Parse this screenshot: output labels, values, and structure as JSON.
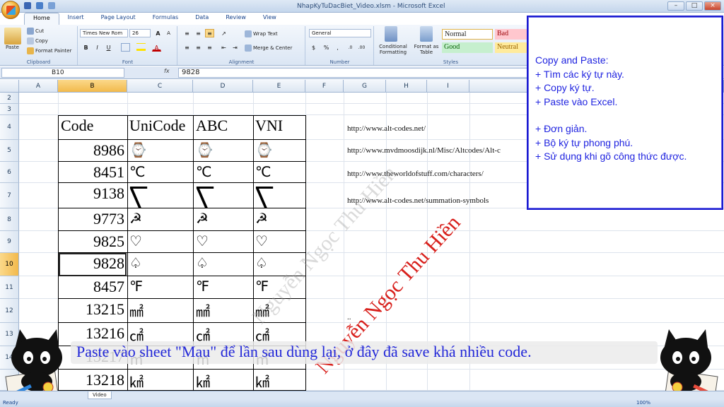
{
  "window": {
    "title": "NhapKyTuDacBiet_Video.xlsm - Microsoft Excel"
  },
  "ribbon_tabs": [
    "Home",
    "Insert",
    "Page Layout",
    "Formulas",
    "Data",
    "Review",
    "View"
  ],
  "clipboard": {
    "paste": "Paste",
    "cut": "Cut",
    "copy": "Copy",
    "format_painter": "Format Painter",
    "label": "Clipboard"
  },
  "font": {
    "name": "Times New Rom",
    "size": "26",
    "bold": "B",
    "italic": "I",
    "underline": "U",
    "grow": "A",
    "shrink": "A",
    "label": "Font"
  },
  "alignment": {
    "wrap_text": "Wrap Text",
    "merge_center": "Merge & Center",
    "label": "Alignment"
  },
  "number": {
    "format": "General",
    "currency": "$",
    "percent": "%",
    "comma": ",",
    "label": "Number"
  },
  "styles": {
    "conditional_formatting": "Conditional Formatting",
    "format_as_table": "Format as Table",
    "label": "Styles",
    "normal": "Normal",
    "bad": "Bad",
    "good": "Good",
    "neutral": "Neutral"
  },
  "formula_bar": {
    "name_box": "B10",
    "fx": "fx",
    "formula": "9828"
  },
  "columns": [
    "A",
    "B",
    "C",
    "D",
    "E",
    "F",
    "G",
    "H",
    "I"
  ],
  "rows": [
    "2",
    "3",
    "4",
    "5",
    "6",
    "7",
    "8",
    "9",
    "10",
    "11",
    "12",
    "13",
    "14",
    "15"
  ],
  "table": {
    "headers": [
      "Code",
      "UniCode",
      "ABC",
      "VNI"
    ],
    "rows": [
      {
        "code": "8986",
        "glyph": "⌚"
      },
      {
        "code": "8451",
        "glyph": "℃"
      },
      {
        "code": "9138",
        "glyph": "⎲"
      },
      {
        "code": "9773",
        "glyph": "☭"
      },
      {
        "code": "9825",
        "glyph": "♡"
      },
      {
        "code": "9828",
        "glyph": "♤"
      },
      {
        "code": "8457",
        "glyph": "℉"
      },
      {
        "code": "13215",
        "glyph": "㎟"
      },
      {
        "code": "13216",
        "glyph": "㎠"
      },
      {
        "code": "13217",
        "glyph": "㎡"
      },
      {
        "code": "13218",
        "glyph": "㎢"
      }
    ]
  },
  "links": [
    "http://www.alt-codes.net/",
    "http://www.mvdmoosdijk.nl/Misc/Altcodes/Alt-c",
    "http://www.theworldofstuff.com/characters/",
    "http://www.alt-codes.net/summation-symbols",
    ".."
  ],
  "watermark": "Nguyễn Ngọc Thu Hiền",
  "note": {
    "lines": [
      "Copy and Paste:",
      "+ Tìm các ký tự này.",
      "+ Copy ký tự.",
      "+ Paste vào Excel.",
      "",
      "+ Đơn giản.",
      "+ Bộ ký tự phong phú.",
      "+ Sử dụng khi gõ công thức được."
    ]
  },
  "caption": "Paste vào sheet \"Mau\" để lần sau dùng lại, ở đây đã save khá nhiều code.",
  "sheet_tab": "Video",
  "status": {
    "ready": "Ready",
    "zoom": "100%"
  },
  "colors": {
    "accent": "#2024e0",
    "watermark_red": "#d8201c",
    "ribbon": "#dbe6f4"
  }
}
